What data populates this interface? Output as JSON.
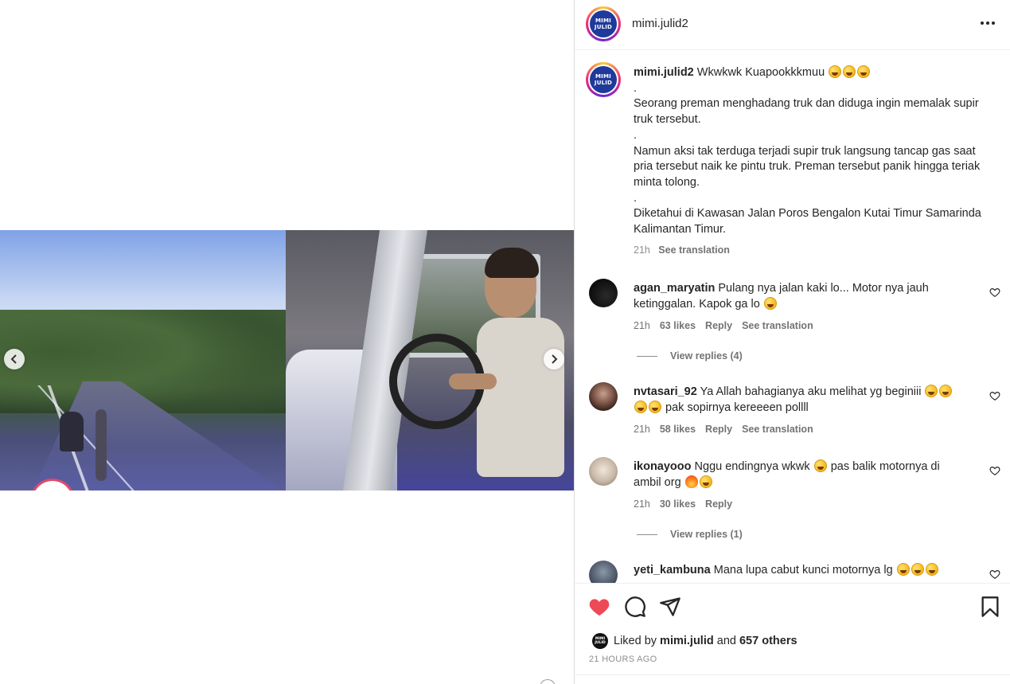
{
  "post": {
    "username": "mimi.julid2",
    "logo_text": [
      "MIMI",
      "JULID"
    ],
    "caption": {
      "user": "mimi.julid2",
      "lines": [
        "Wkwkwk Kuapookkkmuu",
        ".",
        "Seorang preman menghadang truk dan diduga ingin memalak supir truk tersebut.",
        ".",
        "Namun aksi tak terduga terjadi supir truk langsung tancap gas saat pria tersebut naik ke pintu truk. Preman tersebut panik hingga teriak minta tolong.",
        ".",
        "Diketahui di Kawasan Jalan Poros Bengalon Kutai Timur Samarinda Kalimantan Timur."
      ],
      "time": "21h",
      "see_translation": "See translation"
    },
    "comments": [
      {
        "user": "agan_maryatin",
        "text": "Pulang nya jalan kaki lo... Motor nya jauh ketinggalan. Kapok ga lo",
        "time": "21h",
        "likes": "63 likes",
        "reply": "Reply",
        "see_translation": "See translation",
        "view_replies": "View replies (4)"
      },
      {
        "user": "nvtasari_92",
        "text": "Ya Allah bahagianya aku melihat yg beginiii",
        "text2": "pak sopirnya kereeeen pollll",
        "time": "21h",
        "likes": "58 likes",
        "reply": "Reply",
        "see_translation": "See translation"
      },
      {
        "user": "ikonayooo",
        "text": "Nggu endingnya wkwk",
        "text2": "pas balik motornya di",
        "text3": "ambil org",
        "time": "21h",
        "likes": "30 likes",
        "reply": "Reply",
        "view_replies": "View replies (1)"
      },
      {
        "user": "yeti_kambuna",
        "text": "Mana lupa cabut kunci motornya lg"
      }
    ],
    "liked_by": {
      "prefix": "Liked by",
      "user": "mimi.julid",
      "and": "and",
      "others": "657 others",
      "avatar_text": "MIMI JULID"
    },
    "timestamp": "21 HOURS AGO"
  },
  "colors": {
    "heart_liked": "#ed4956",
    "text": "#262626",
    "muted": "#737373",
    "brand_logo": "#1f3a9a"
  },
  "icons": [
    "chevron-left-icon",
    "chevron-right-icon",
    "more-icon",
    "heart-icon",
    "comment-icon",
    "share-icon",
    "bookmark-icon"
  ]
}
